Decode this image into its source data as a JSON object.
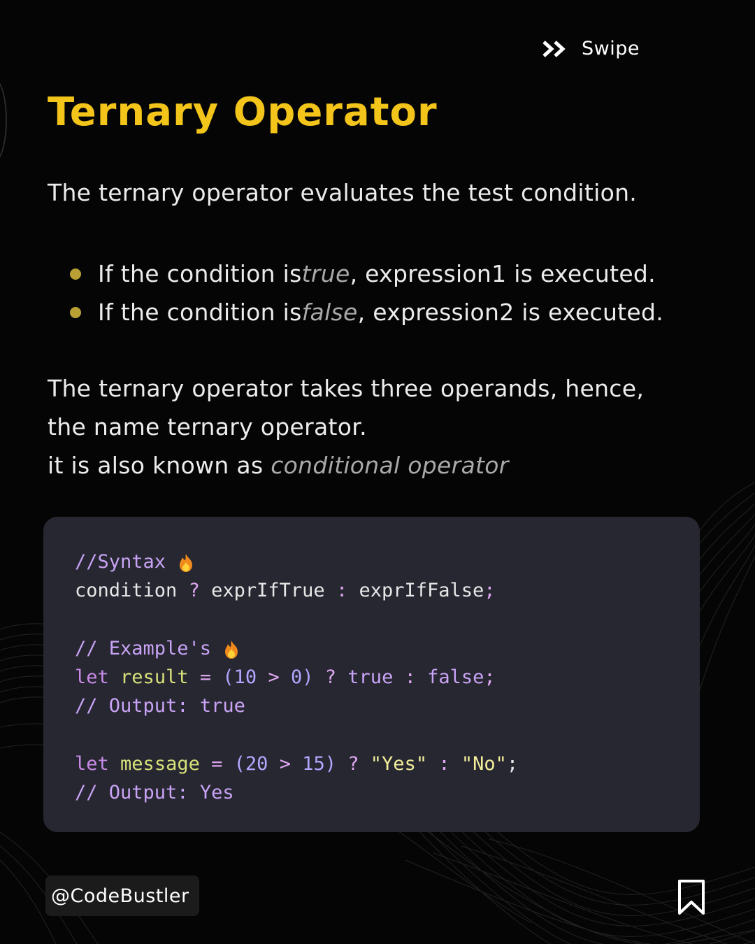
{
  "header": {
    "swipe_label": "Swipe",
    "swipe_icon": "double-chevron-right-icon"
  },
  "title": "Ternary Operator",
  "intro": "The ternary operator evaluates the test condition.",
  "bullets": [
    {
      "prefix": "If the condition is ",
      "emphasis": "true",
      "suffix": ", expression1 is executed."
    },
    {
      "prefix": "If the condition is ",
      "emphasis": "false",
      "suffix": ", expression2 is executed."
    }
  ],
  "paragraph": {
    "line1": "The ternary operator takes three operands, hence,",
    "line2": "the name ternary operator.",
    "line3_prefix": "it is also known as ",
    "line3_emphasis": "conditional operator"
  },
  "code": {
    "syntax_comment": "//Syntax",
    "syntax_line": {
      "condition": "condition",
      "q": "?",
      "expr_true": "exprIfTrue",
      "colon": ":",
      "expr_false": "exprIfFalse",
      "semi": ";"
    },
    "examples_comment": "// Example's",
    "example1": {
      "kw": "let",
      "var": "result",
      "eq": "=",
      "open": "(",
      "a": "10",
      "gt": ">",
      "b": "0",
      "close": ")",
      "q": "?",
      "t": "true",
      "colon": ":",
      "f": "false",
      "semi": ";"
    },
    "example1_output": {
      "label": "// Output:",
      "value": "true"
    },
    "example2": {
      "kw": "let",
      "var": "message",
      "eq": "=",
      "open": "(",
      "a": "20",
      "gt": ">",
      "b": "15",
      "close": ")",
      "q": "?",
      "yes": "\"Yes\"",
      "colon": ":",
      "no": "\"No\"",
      "semi": ";"
    },
    "example2_output": {
      "label": "// Output:",
      "value": "Yes"
    },
    "emoji_icon": "fire-icon"
  },
  "footer": {
    "handle": "@CodeBustler",
    "bookmark_icon": "bookmark-icon"
  },
  "colors": {
    "accent": "#f3c41a",
    "background": "#050505",
    "code_bg": "#262731",
    "bullet": "#b9a034"
  }
}
